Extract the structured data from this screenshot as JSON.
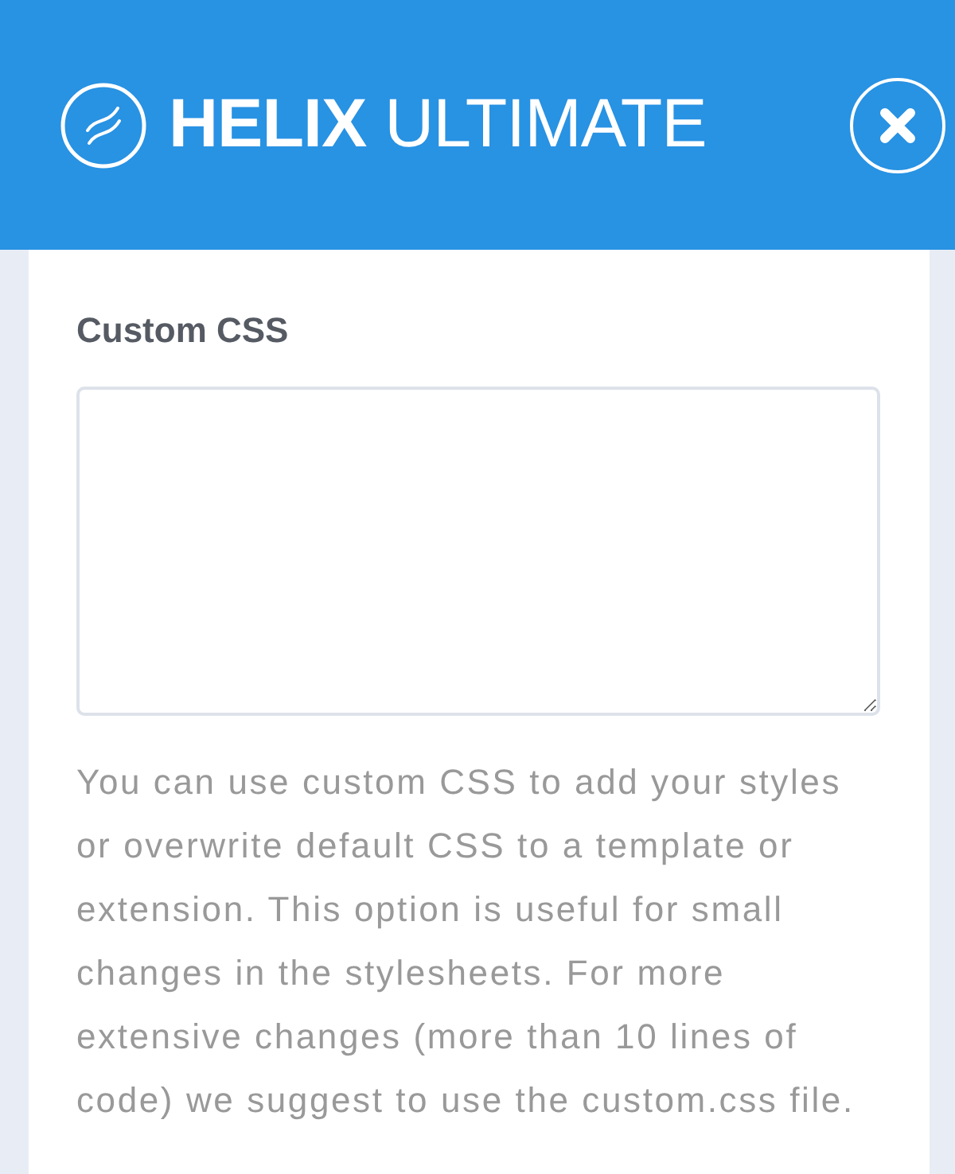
{
  "header": {
    "logo_text": "**HELIX** ULTIMATE"
  },
  "field": {
    "label": "Custom CSS",
    "help": "You can use custom CSS to add your styles or overwrite default CSS to a template or extension. This option is useful for small changes in the stylesheets. For more extensive changes (more than 10 lines of code) we suggest to use the custom.css file."
  }
}
